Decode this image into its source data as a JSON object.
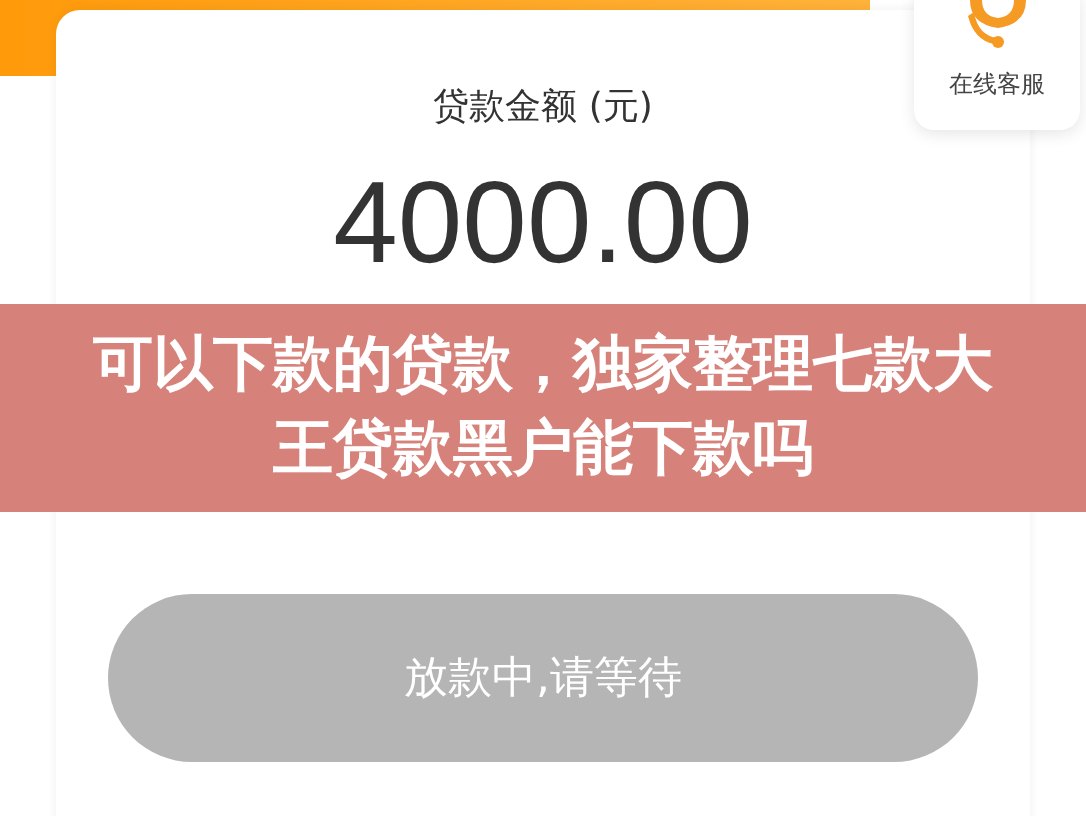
{
  "service_widget": {
    "label": "在线客服"
  },
  "loan_card": {
    "amount_label": "贷款金额 (元)",
    "amount": "4000.00"
  },
  "status_button": {
    "label": "放款中,请等待",
    "disabled": true
  },
  "overlay_title": {
    "text": "可以下款的贷款，独家整理七款大王贷款黑户能下款吗"
  }
}
